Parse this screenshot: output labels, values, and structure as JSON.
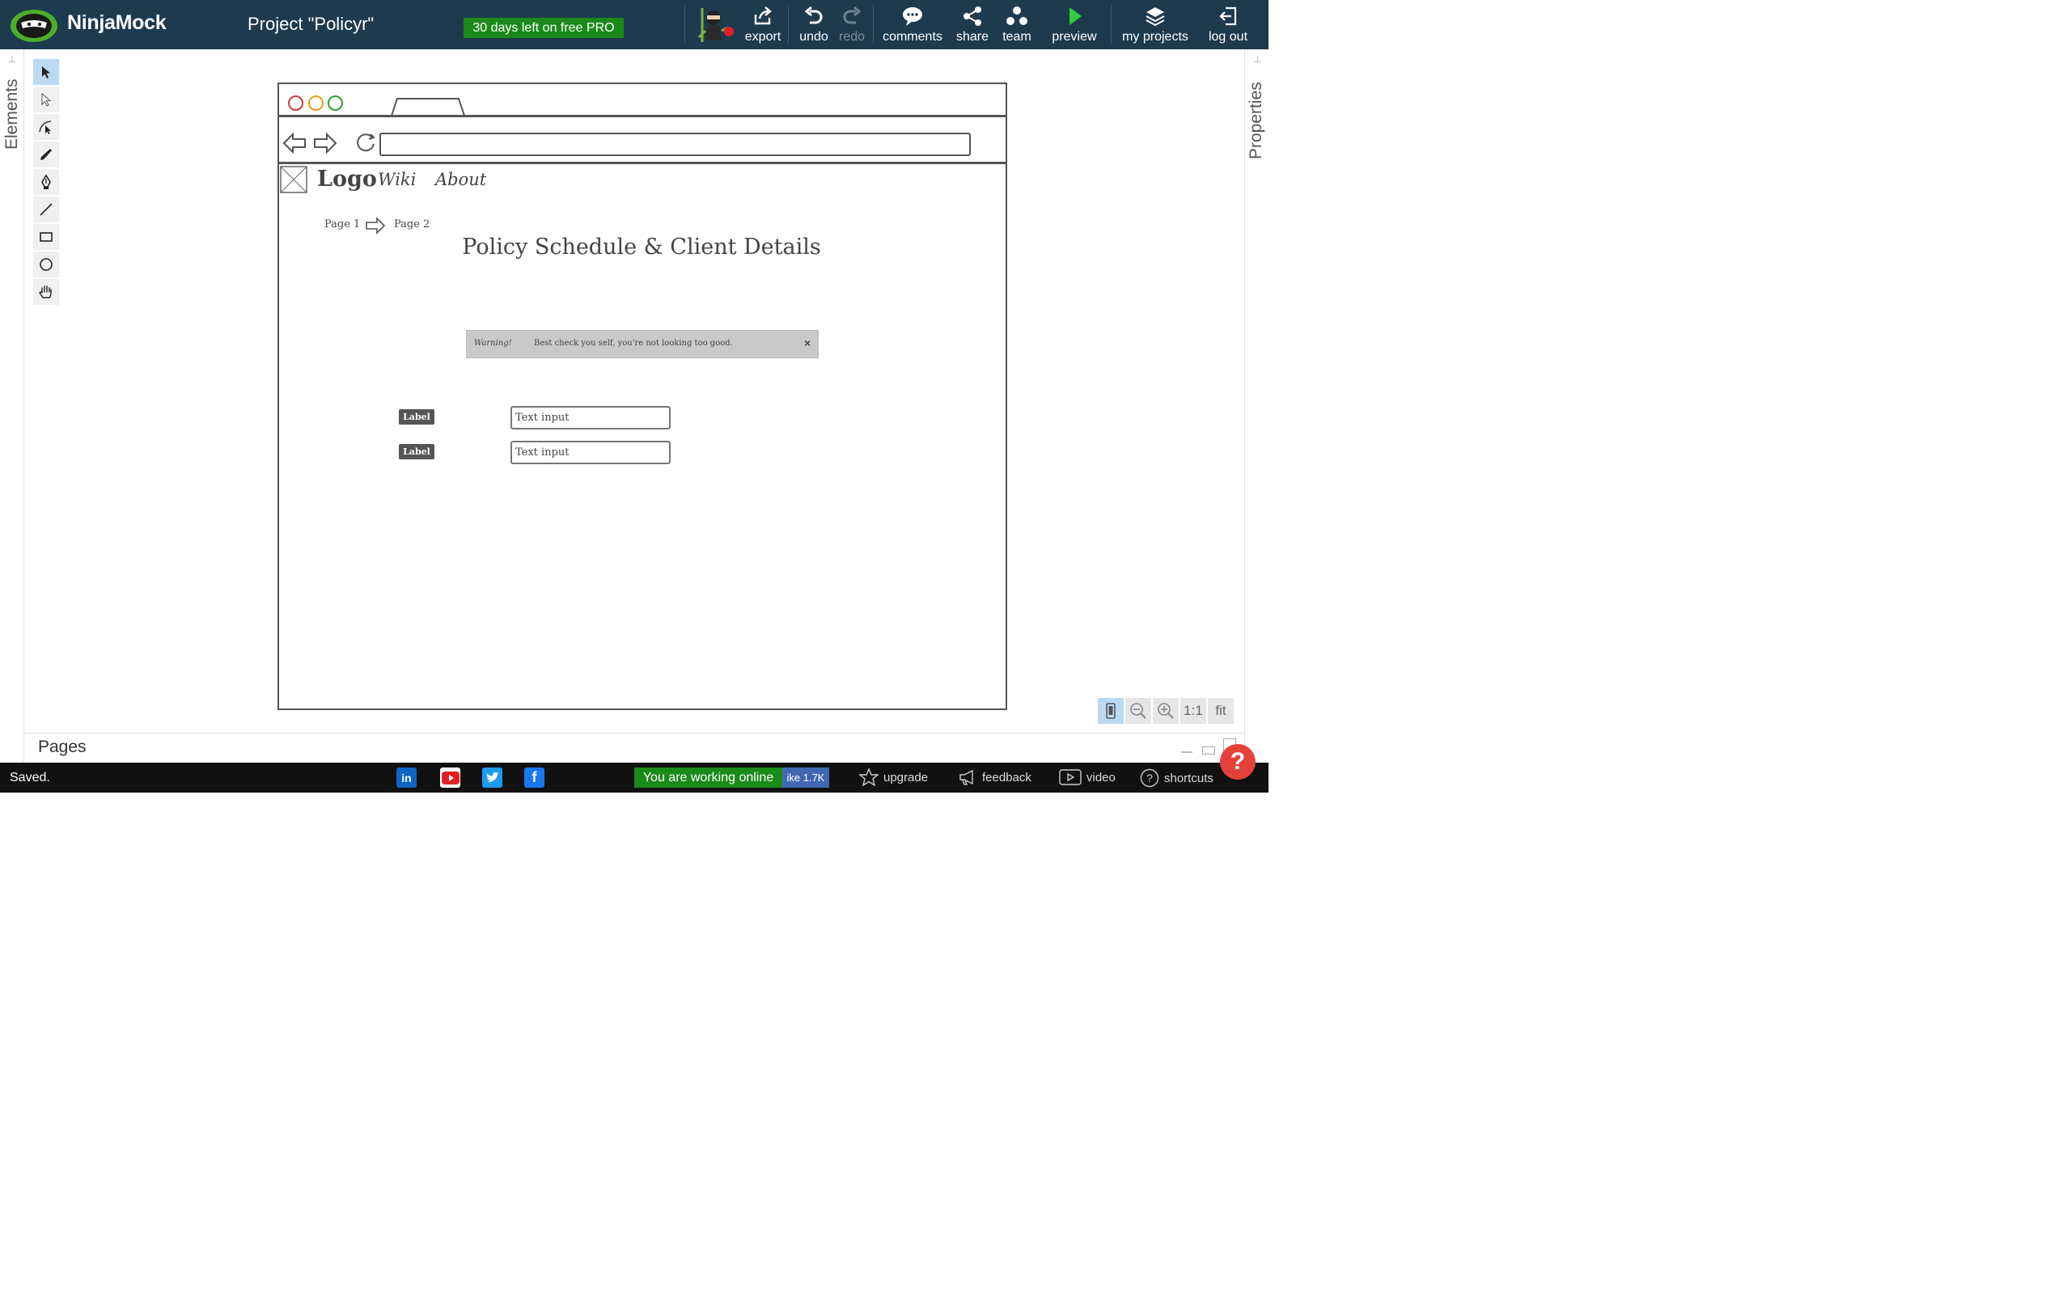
{
  "header": {
    "brand": "NinjaMock",
    "project_title": "Project \"Policyr\"",
    "pro_badge": "30 days left on free PRO",
    "buttons": [
      {
        "label": "export",
        "icon": "export-icon"
      },
      {
        "label": "undo",
        "icon": "undo-icon"
      },
      {
        "label": "redo",
        "icon": "redo-icon",
        "disabled": true
      },
      {
        "label": "comments",
        "icon": "comments-icon"
      },
      {
        "label": "share",
        "icon": "share-icon"
      },
      {
        "label": "team",
        "icon": "team-icon"
      },
      {
        "label": "preview",
        "icon": "play-icon"
      },
      {
        "label": "my projects",
        "icon": "layers-icon"
      },
      {
        "label": "log out",
        "icon": "logout-icon"
      }
    ]
  },
  "panels": {
    "left": "Elements",
    "right": "Properties",
    "bottom": "Pages"
  },
  "tools": [
    "select-arrow",
    "direct-select",
    "path-edit",
    "pencil",
    "pen",
    "line",
    "rectangle",
    "ellipse",
    "hand"
  ],
  "mockup": {
    "nav": {
      "logo": "Logo",
      "links": [
        "Wiki",
        "About"
      ]
    },
    "breadcrumb": {
      "page1": "Page 1",
      "page2": "Page 2"
    },
    "heading": "Policy Schedule & Client Details",
    "alert": {
      "title": "Warning!",
      "message": "Best check you self, you're not looking too good.",
      "close": "×"
    },
    "form_rows": [
      {
        "label": "Label",
        "placeholder": "Text input"
      },
      {
        "label": "Label",
        "placeholder": "Text input"
      }
    ]
  },
  "zoom": {
    "one_to_one": "1:1",
    "fit": "fit"
  },
  "status": {
    "saved": "Saved.",
    "online": "You are working online",
    "like_count": "ike 1.7K",
    "links": [
      "upgrade",
      "feedback",
      "video",
      "shortcuts"
    ]
  },
  "colors": {
    "topbar": "#1e3a4f",
    "pro_badge": "#1a8a1a",
    "online_badge": "#1a8a1a",
    "help": "#e5403a"
  }
}
